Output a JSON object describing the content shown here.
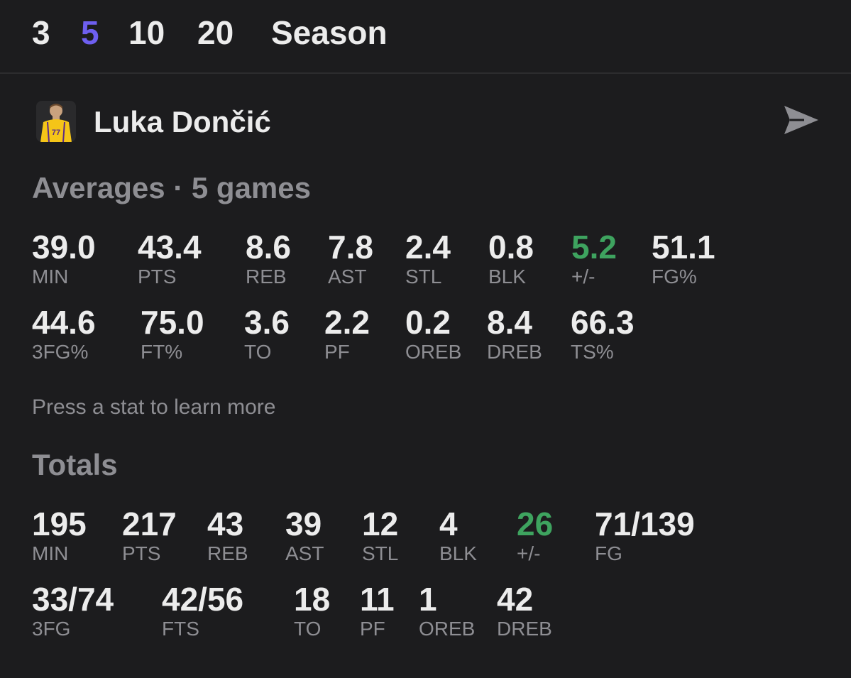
{
  "range_tabs": [
    "3",
    "5",
    "10",
    "20",
    "Season"
  ],
  "active_tab": "5",
  "accent_color": "#6e5ff0",
  "positive_color": "#3ea35f",
  "player": {
    "name": "Luka Dončić",
    "jersey_number": "77"
  },
  "averages": {
    "title": "Averages · 5 games",
    "row1": [
      {
        "value": "39.0",
        "label": "MIN"
      },
      {
        "value": "43.4",
        "label": "PTS"
      },
      {
        "value": "8.6",
        "label": "REB"
      },
      {
        "value": "7.8",
        "label": "AST"
      },
      {
        "value": "2.4",
        "label": "STL"
      },
      {
        "value": "0.8",
        "label": "BLK"
      },
      {
        "value": "5.2",
        "label": "+/-"
      },
      {
        "value": "51.1",
        "label": "FG%"
      }
    ],
    "row2": [
      {
        "value": "44.6",
        "label": "3FG%"
      },
      {
        "value": "75.0",
        "label": "FT%"
      },
      {
        "value": "3.6",
        "label": "TO"
      },
      {
        "value": "2.2",
        "label": "PF"
      },
      {
        "value": "0.2",
        "label": "OREB"
      },
      {
        "value": "8.4",
        "label": "DREB"
      },
      {
        "value": "66.3",
        "label": "TS%"
      }
    ]
  },
  "hint": "Press a stat to learn more",
  "totals": {
    "title": "Totals",
    "row1": [
      {
        "value": "195",
        "label": "MIN"
      },
      {
        "value": "217",
        "label": "PTS"
      },
      {
        "value": "43",
        "label": "REB"
      },
      {
        "value": "39",
        "label": "AST"
      },
      {
        "value": "12",
        "label": "STL"
      },
      {
        "value": "4",
        "label": "BLK"
      },
      {
        "value": "26",
        "label": "+/-"
      },
      {
        "value": "71/139",
        "label": "FG"
      }
    ],
    "row2": [
      {
        "value": "33/74",
        "label": "3FG"
      },
      {
        "value": "42/56",
        "label": "FTS"
      },
      {
        "value": "18",
        "label": "TO"
      },
      {
        "value": "11",
        "label": "PF"
      },
      {
        "value": "1",
        "label": "OREB"
      },
      {
        "value": "42",
        "label": "DREB"
      }
    ]
  }
}
